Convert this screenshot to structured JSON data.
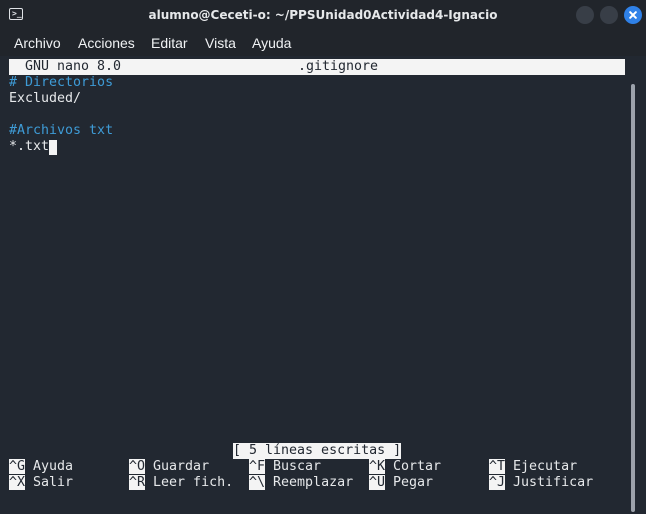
{
  "window": {
    "title": "alumno@Ceceti-o: ~/PPSUnidad0Actividad4-Ignacio"
  },
  "menubar": {
    "items": [
      "Archivo",
      "Acciones",
      "Editar",
      "Vista",
      "Ayuda"
    ]
  },
  "nano": {
    "version": "GNU nano 8.0",
    "filename": ".gitignore",
    "lines": [
      "# Directorios",
      "Excluded/",
      "",
      "#Archivos txt",
      "*.txt"
    ],
    "status": "[ 5 líneas escritas ]",
    "shortcuts": [
      [
        {
          "key": "^G",
          "label": "Ayuda"
        },
        {
          "key": "^O",
          "label": "Guardar"
        },
        {
          "key": "^F",
          "label": "Buscar"
        },
        {
          "key": "^K",
          "label": "Cortar"
        },
        {
          "key": "^T",
          "label": "Ejecutar"
        }
      ],
      [
        {
          "key": "^X",
          "label": "Salir"
        },
        {
          "key": "^R",
          "label": "Leer fich."
        },
        {
          "key": "^\\",
          "label": "Reemplazar"
        },
        {
          "key": "^U",
          "label": "Pegar"
        },
        {
          "key": "^J",
          "label": "Justificar"
        }
      ]
    ]
  },
  "colors": {
    "background": "#222831",
    "accent": "#2f81e8",
    "comment": "#3e9bd6",
    "inverse": "#f4f4f4"
  },
  "icons": {
    "app": "terminal-icon",
    "minimize": "minimize-icon",
    "maximize": "maximize-icon",
    "close": "close-icon"
  }
}
